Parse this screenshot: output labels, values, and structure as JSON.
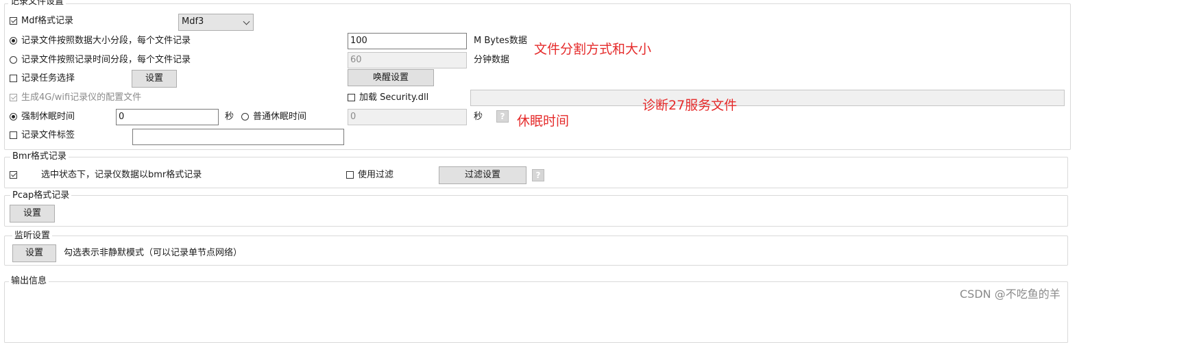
{
  "record_settings": {
    "title": "记录文件设置",
    "mdf_label": "Mdf格式记录",
    "mdf_select_value": "Mdf3",
    "split_by_size_label": "记录文件按照数据大小分段，每个文件记录",
    "split_size_value": "100",
    "split_size_unit": "M Bytes数据",
    "split_by_time_label": "记录文件按照记录时间分段，每个文件记录",
    "split_time_value": "60",
    "split_time_unit": "分钟数据",
    "task_select_label": "记录任务选择",
    "task_settings_button": "设置",
    "wakeup_settings_button": "唤醒设置",
    "gen_config_label": "生成4G/wifi记录仪的配置文件",
    "load_security_label": "加载 Security.dll",
    "security_path_value": "",
    "forced_sleep_label": "强制休眠时间",
    "forced_sleep_value": "0",
    "forced_sleep_unit": "秒",
    "normal_sleep_label": "普通休眠时间",
    "normal_sleep_value": "0",
    "normal_sleep_unit": "秒",
    "file_tag_label": "记录文件标签",
    "file_tag_value": ""
  },
  "bmr": {
    "title": "Bmr格式记录",
    "desc": "选中状态下，记录仪数据以bmr格式记录",
    "use_filter_label": "使用过滤",
    "filter_settings_button": "过滤设置"
  },
  "pcap": {
    "title": "Pcap格式记录",
    "settings_button": "设置"
  },
  "monitor": {
    "title": "监听设置",
    "settings_button": "设置",
    "desc": "勾选表示非静默模式（可以记录单节点网络）"
  },
  "output": {
    "title": "输出信息"
  },
  "annotations": {
    "split_note": "文件分割方式和大小",
    "diag_note": "诊断27服务文件",
    "sleep_note": "休眠时间"
  },
  "help_glyph": "?",
  "watermark": "CSDN @不吃鱼的羊",
  "colors": {
    "annotation": "#e52b2b"
  }
}
